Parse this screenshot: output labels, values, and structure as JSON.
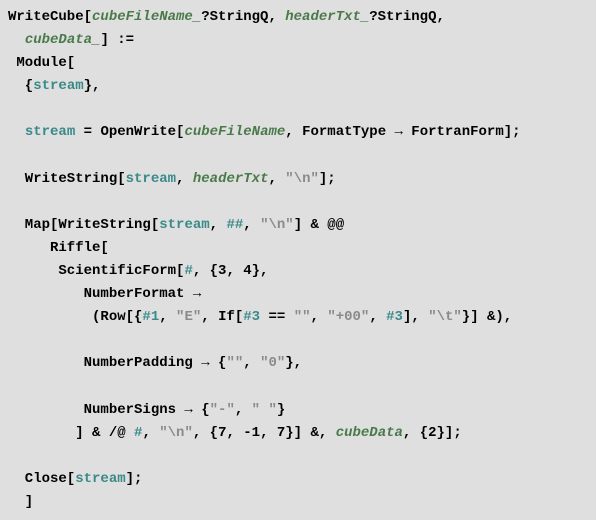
{
  "code": {
    "l1": {
      "t1": "WriteCube[",
      "p1": "cubeFileName_",
      "t2": "?StringQ, ",
      "p2": "headerTxt_",
      "t3": "?StringQ,"
    },
    "l2": {
      "t1": "  ",
      "p1": "cubeData_",
      "t2": "] :="
    },
    "l3": {
      "t1": " Module["
    },
    "l4": {
      "t1": "  {",
      "v1": "stream",
      "t2": "},"
    },
    "l5": {
      "t1": "  "
    },
    "l6": {
      "t1": "  ",
      "v1": "stream",
      "t2": " = OpenWrite[",
      "p1": "cubeFileName",
      "t3": ", FormatType → FortranForm];"
    },
    "l7": {
      "t1": "  "
    },
    "l8": {
      "t1": "  WriteString[",
      "v1": "stream",
      "t2": ", ",
      "p1": "headerTxt",
      "t3": ", ",
      "s1": "\"\\n\"",
      "t4": "];"
    },
    "l9": {
      "t1": "  "
    },
    "l10": {
      "t1": "  Map[WriteString[",
      "v1": "stream",
      "t2": ", ",
      "slot1": "##",
      "t3": ", ",
      "s1": "\"\\n\"",
      "t4": "] & @@"
    },
    "l11": {
      "t1": "     Riffle["
    },
    "l12": {
      "t1": "      ScientificForm[",
      "slot1": "#",
      "t2": ", {3, 4},"
    },
    "l13": {
      "t1": "         NumberFormat →"
    },
    "l14": {
      "t1": "          (Row[{",
      "slot1": "#1",
      "t2": ", ",
      "s1": "\"E\"",
      "t3": ", If[",
      "slot2": "#3",
      "t4": " == ",
      "s2": "\"\"",
      "t5": ", ",
      "s3": "\"+00\"",
      "t6": ", ",
      "slot3": "#3",
      "t7": "], ",
      "s4": "\"\\t\"",
      "t8": "}] &),"
    },
    "l15": {
      "t1": "         "
    },
    "l16": {
      "t1": "         NumberPadding → {",
      "s1": "\"\"",
      "t2": ", ",
      "s2": "\"0\"",
      "t3": "},"
    },
    "l17": {
      "t1": "         "
    },
    "l18": {
      "t1": "         NumberSigns → {",
      "s1": "\"-\"",
      "t2": ", ",
      "s2": "\" \"",
      "t3": "}"
    },
    "l19": {
      "t1": "        ] & /@ ",
      "slot1": "#",
      "t2": ", ",
      "s1": "\"\\n\"",
      "t3": ", {7, -1, 7}] &, ",
      "p1": "cubeData",
      "t4": ", {2}];"
    },
    "l20": {
      "t1": "  "
    },
    "l21": {
      "t1": "  Close[",
      "v1": "stream",
      "t2": "];"
    },
    "l22": {
      "t1": "  ]"
    }
  }
}
